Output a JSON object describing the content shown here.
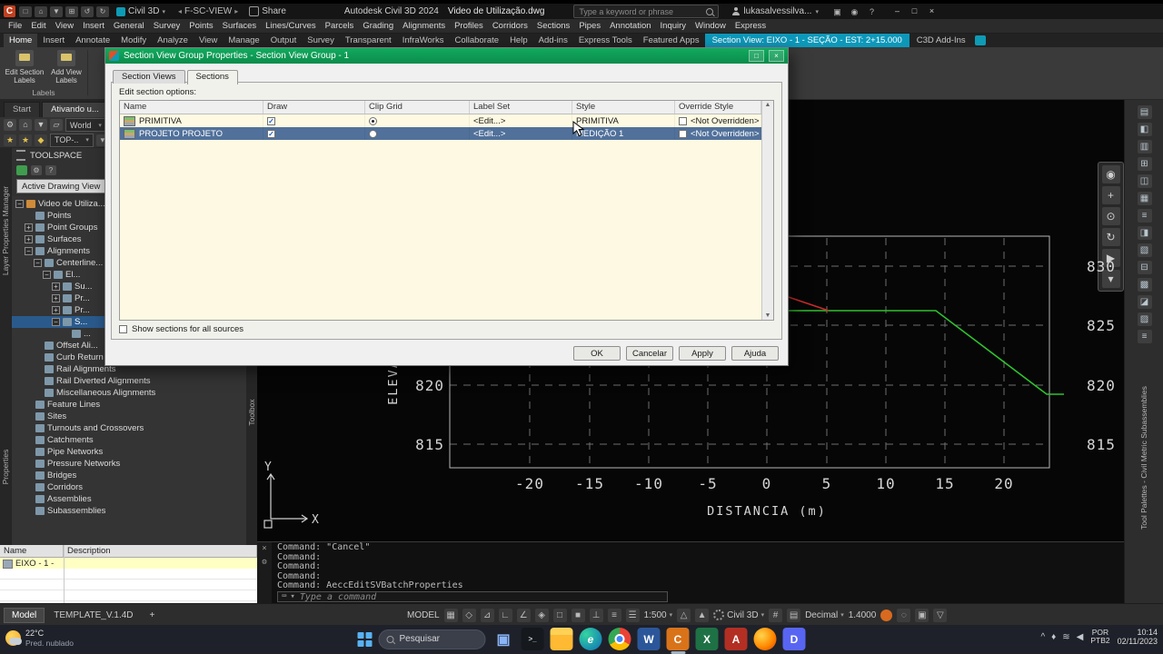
{
  "titlebar": {
    "app_initial": "C",
    "qat_icons": [
      "new-icon",
      "open-icon",
      "save-icon",
      "plot-icon",
      "undo-icon",
      "redo-icon"
    ],
    "workspace_label": "Civil 3D",
    "layout_label": "F-SC-VIEW",
    "share_label": "Share",
    "app_title": "Autodesk Civil 3D 2024",
    "doc_title": "Video de Utilização.dwg",
    "search_placeholder": "Type a keyword or phrase",
    "signin_label": "lukasalvessilva...",
    "right_icons": [
      "cart-icon",
      "bell-icon",
      "help-icon"
    ]
  },
  "menu": {
    "items": [
      "File",
      "Edit",
      "View",
      "Insert",
      "General",
      "Survey",
      "Points",
      "Surfaces",
      "Lines/Curves",
      "Parcels",
      "Grading",
      "Alignments",
      "Profiles",
      "Corridors",
      "Sections",
      "Pipes",
      "Annotation",
      "Inquiry",
      "Window",
      "Express"
    ]
  },
  "ribbon": {
    "tabs": [
      "Home",
      "Insert",
      "Annotate",
      "Modify",
      "Analyze",
      "View",
      "Manage",
      "Output",
      "Survey",
      "Transparent",
      "InfraWorks",
      "Collaborate",
      "Help",
      "Add-ins",
      "Express Tools",
      "Featured Apps"
    ],
    "contextual_tab": "Section View: EIXO - 1 - SEÇÃO - EST: 2+15.000",
    "addins_tab": "C3D Add-Ins",
    "buttons": [
      "Edit Section Labels",
      "Add View Labels"
    ],
    "group_caption": "Labels"
  },
  "file_tabs": [
    "Start",
    "Ativando u..."
  ],
  "toolbars": {
    "row1_icons": [
      "workspace-gear-icon",
      "open-icon",
      "save-icon",
      "match-properties-icon"
    ],
    "world_label": "World",
    "row1_after": [
      "layer-icon",
      "layer-state-icon"
    ],
    "row2_icons": [
      "favorites-icon",
      "style-icon",
      "swatch-icon"
    ],
    "style_label": "TOP-..",
    "row2_after": [
      "annotation-scale-icon"
    ]
  },
  "toolspace": {
    "title": "TOOLSPACE",
    "toolbar_icons": [
      "active-drawing-icon",
      "settings-icon",
      "panel-help-icon"
    ],
    "view_selector": "Active Drawing View",
    "tree": [
      {
        "label": "Video de Utiliza...",
        "depth": 0,
        "expander": "-",
        "root": true
      },
      {
        "label": "Points",
        "depth": 1,
        "expander": null
      },
      {
        "label": "Point Groups",
        "depth": 1,
        "expander": "+"
      },
      {
        "label": "Surfaces",
        "depth": 1,
        "expander": "+"
      },
      {
        "label": "Alignments",
        "depth": 1,
        "expander": "-"
      },
      {
        "label": "Centerline...",
        "depth": 2,
        "expander": "-"
      },
      {
        "label": "El...",
        "depth": 3,
        "expander": "-"
      },
      {
        "label": "Su...",
        "depth": 4,
        "expander": "+"
      },
      {
        "label": "Pr...",
        "depth": 4,
        "expander": "+"
      },
      {
        "label": "Pr...",
        "depth": 4,
        "expander": "+"
      },
      {
        "label": "S...",
        "depth": 4,
        "expander": "-",
        "selected": true
      },
      {
        "label": "...",
        "depth": 5,
        "expander": null
      },
      {
        "label": "Offset Ali...",
        "depth": 2,
        "expander": null
      },
      {
        "label": "Curb Return Alignments",
        "depth": 2,
        "expander": null
      },
      {
        "label": "Rail Alignments",
        "depth": 2,
        "expander": null
      },
      {
        "label": "Rail Diverted Alignments",
        "depth": 2,
        "expander": null
      },
      {
        "label": "Miscellaneous Alignments",
        "depth": 2,
        "expander": null
      },
      {
        "label": "Feature Lines",
        "depth": 1,
        "expander": null
      },
      {
        "label": "Sites",
        "depth": 1,
        "expander": null
      },
      {
        "label": "Turnouts and Crossovers",
        "depth": 1,
        "expander": null
      },
      {
        "label": "Catchments",
        "depth": 1,
        "expander": null
      },
      {
        "label": "Pipe Networks",
        "depth": 1,
        "expander": null
      },
      {
        "label": "Pressure Networks",
        "depth": 1,
        "expander": null
      },
      {
        "label": "Bridges",
        "depth": 1,
        "expander": null
      },
      {
        "label": "Corridors",
        "depth": 1,
        "expander": null
      },
      {
        "label": "Assemblies",
        "depth": 1,
        "expander": null
      },
      {
        "label": "Subassemblies",
        "depth": 1,
        "expander": null
      }
    ]
  },
  "bottom_list": {
    "columns": [
      "Name",
      "Description"
    ],
    "row_name": "EIXO - 1 -"
  },
  "side_labels": {
    "layer_manager": "Layer Properties Manager",
    "properties": "Properties",
    "toolbox": "Toolbox",
    "tool_palettes": "Tool Palettes - Civil Metric Subassemblies"
  },
  "dialog": {
    "title": "Section View Group Properties - Section View Group - 1",
    "tabs": [
      "Section Views",
      "Sections"
    ],
    "active_tab": "Sections",
    "options_label": "Edit section options:",
    "columns": [
      "Name",
      "Draw",
      "Clip Grid",
      "Label Set",
      "Style",
      "Override Style"
    ],
    "rows": [
      {
        "name": "PRIMITIVA",
        "draw": true,
        "clip": true,
        "label_set": "<Edit...>",
        "style": "PRIMITIVA",
        "override_label": "<Not Overridden>",
        "selected": false
      },
      {
        "name": "PROJETO PROJETO",
        "draw": true,
        "clip": false,
        "label_set": "<Edit...>",
        "style": "MEDIÇÃO 1",
        "override_label": "<Not Overridden>",
        "selected": true
      }
    ],
    "footer_checkbox": "Show sections for all sources",
    "buttons": [
      "OK",
      "Cancelar",
      "Apply",
      "Ajuda"
    ]
  },
  "viewport": {
    "elevations": [
      "830",
      "825",
      "820",
      "815"
    ],
    "stations": [
      "-20",
      "-15",
      "-10",
      "-5",
      "0",
      "5",
      "10",
      "15",
      "20"
    ],
    "xlabel": "DISTANCIA  (m)",
    "ylabel": "ELEVAÇÃO  (m)",
    "ucs_y": "Y",
    "ucs_x": "X",
    "profile_color": "#2ec22e",
    "secondary_color": "#cf2b2b",
    "navbar_icons": [
      "steering-wheel-icon",
      "pan-icon",
      "zoom-icon",
      "orbit-icon",
      "showmotion-icon",
      "navbar-menu-icon"
    ]
  },
  "right_dock": {
    "icon_count": 14
  },
  "command_line": {
    "lines": [
      "Command: \"Cancel\"",
      "Command:",
      "Command:",
      "Command:",
      "Command: AeccEditSVBatchProperties"
    ],
    "side_icons": [
      "close-icon",
      "customize-icon"
    ],
    "prompt_icons": [
      "keyboard-icon",
      "recent-icon"
    ],
    "prompt": "Type a command"
  },
  "status_bar": {
    "model_tab": "Model",
    "layout_tab": "TEMPLATE_V.1.4D",
    "add_tab": "+",
    "model_label": "MODEL",
    "icons_a": [
      "grid-icon",
      "snap-icon",
      "infer-icon",
      "ortho-icon",
      "polar-icon",
      "isodraft-icon",
      "osnap-icon",
      "3dosnap-icon",
      "ucs-icon",
      "dyninput-icon",
      "lineweight-icon"
    ],
    "scale": "1:500",
    "icons_b": [
      "annotation-icon",
      "autoscale-icon"
    ],
    "workspace": "Civil 3D",
    "icons_c": [
      "units-icon",
      "properties-icon"
    ],
    "units": "Decimal",
    "offset": "1.4000",
    "icons_d": [
      "isolate-icon",
      "graphics-icon",
      "filter-icon"
    ]
  },
  "taskbar": {
    "weather_temp": "22°C",
    "weather_desc": "Pred. nublado",
    "search_placeholder": "Pesquisar",
    "apps": [
      "task-view",
      "terminal",
      "file-explorer",
      "edge",
      "chrome",
      "word",
      "civil-3d",
      "excel",
      "autocad",
      "firefox",
      "discord"
    ],
    "active_app": "civil-3d",
    "tray_icons": [
      "tray-expand-icon",
      "security-icon",
      "network-icon",
      "volume-icon"
    ],
    "lang_line1": "POR",
    "lang_line2": "PTB2",
    "time": "10:14",
    "date": "02/11/2023"
  }
}
